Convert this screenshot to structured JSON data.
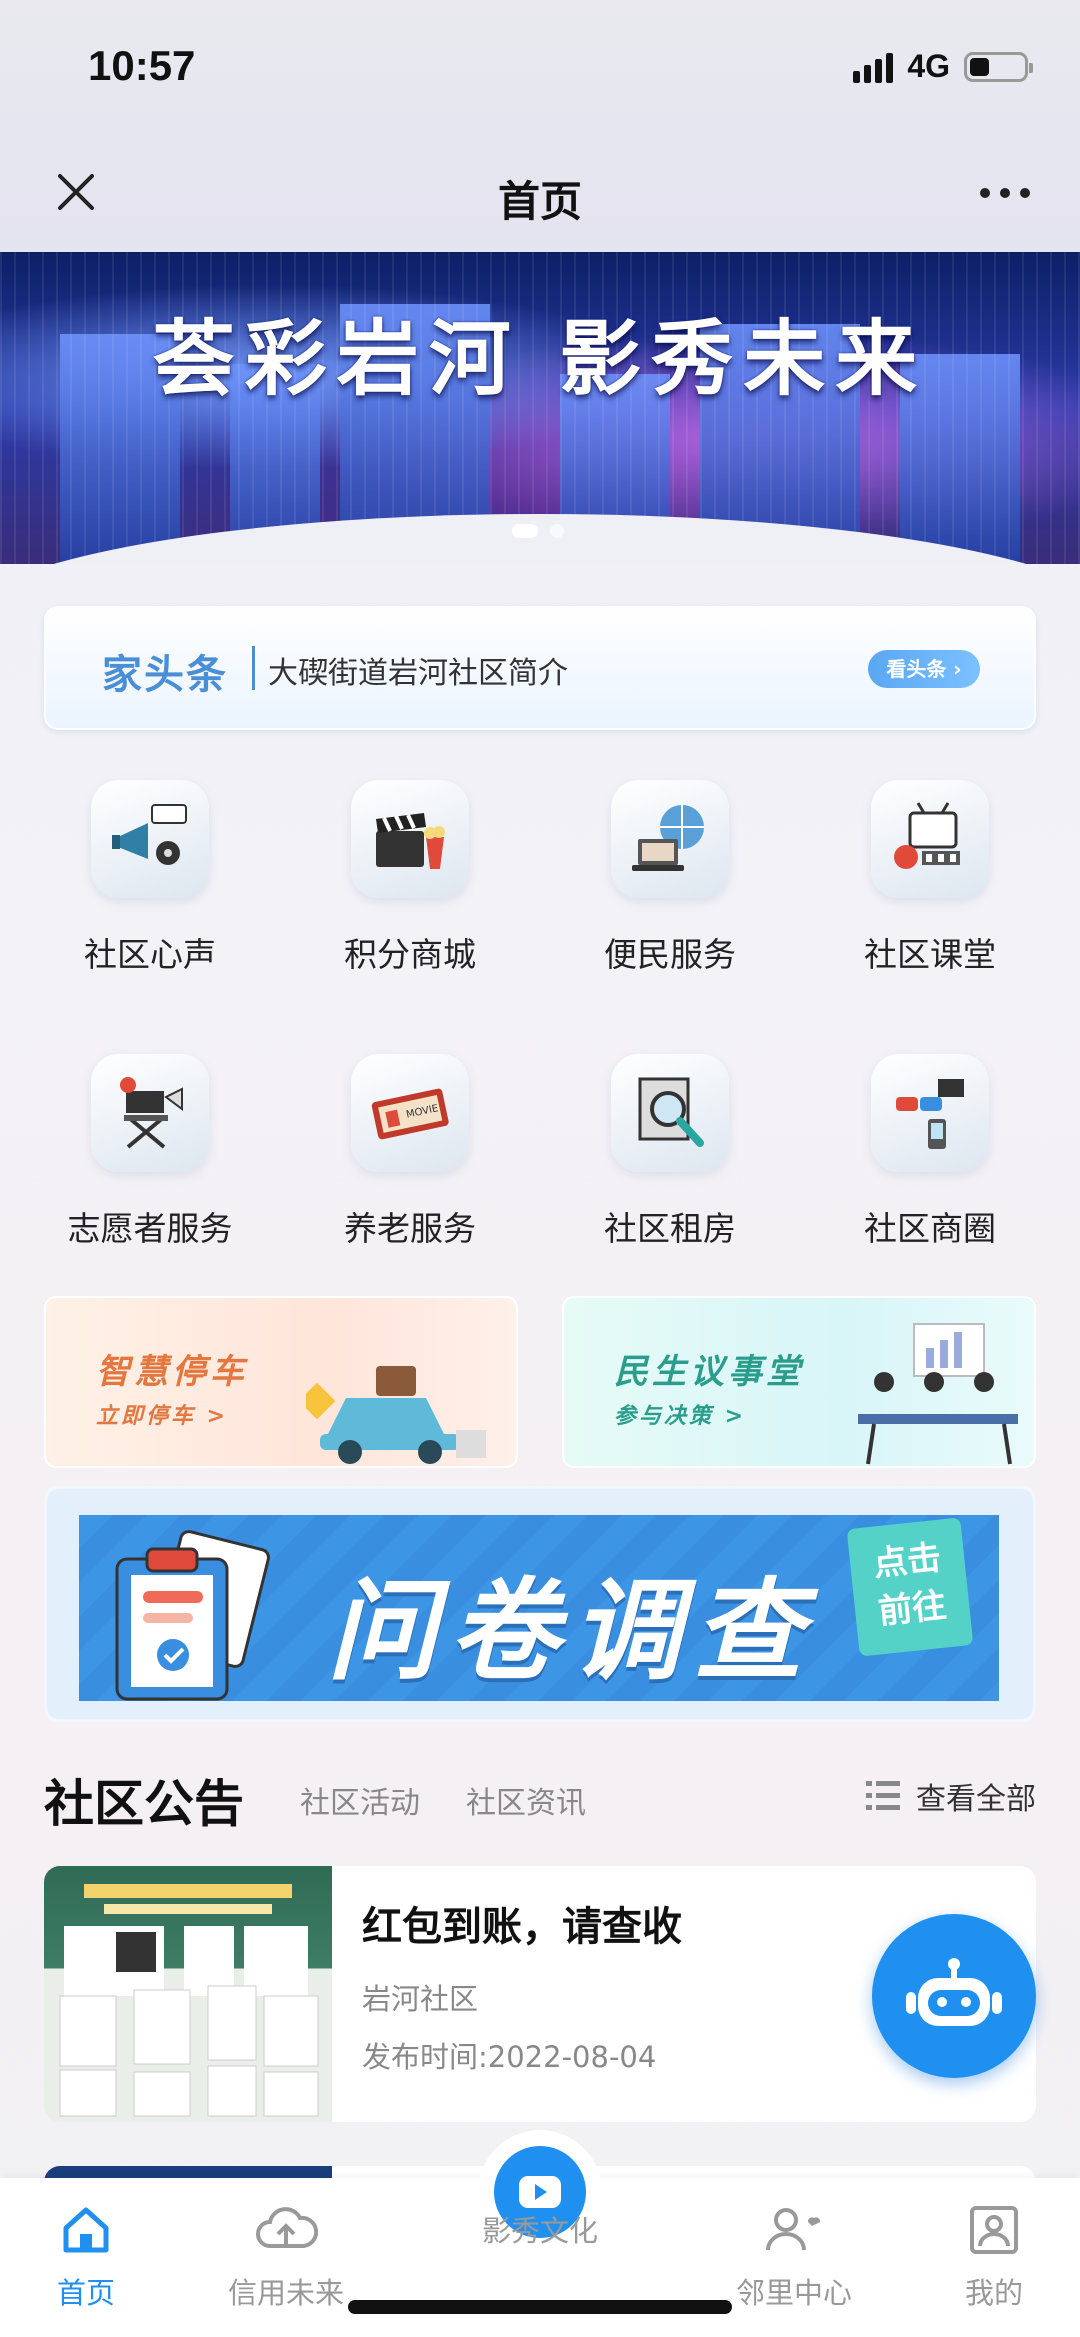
{
  "status": {
    "time": "10:57",
    "network": "4G"
  },
  "nav": {
    "title": "首页"
  },
  "banner": {
    "title": "荟彩岩河 影秀未来"
  },
  "headline": {
    "brand": "家头条",
    "text": "大碶街道岩河社区简介",
    "button": "看头条 ›"
  },
  "grid": [
    {
      "label": "社区心声",
      "icon": "megaphone-icon"
    },
    {
      "label": "积分商城",
      "icon": "clapperboard-icon"
    },
    {
      "label": "便民服务",
      "icon": "globe-laptop-icon"
    },
    {
      "label": "社区课堂",
      "icon": "tv-icon"
    },
    {
      "label": "志愿者服务",
      "icon": "director-chair-icon"
    },
    {
      "label": "养老服务",
      "icon": "movie-ticket-icon"
    },
    {
      "label": "社区租房",
      "icon": "magnifier-icon"
    },
    {
      "label": "社区商圈",
      "icon": "3d-glasses-icon"
    }
  ],
  "cards": {
    "parking": {
      "title": "智慧停车",
      "sub": "立即停车 >"
    },
    "council": {
      "title": "民生议事堂",
      "sub": "参与决策 >"
    }
  },
  "survey": {
    "title": "问卷调查",
    "sign": "点击前往"
  },
  "section": {
    "title": "社区公告",
    "tab1": "社区活动",
    "tab2": "社区资讯",
    "view_all": "查看全部"
  },
  "news": {
    "title": "红包到账，请查收",
    "source": "岩河社区",
    "date": "发布时间:2022-08-04"
  },
  "tabs": [
    {
      "label": "首页",
      "icon": "home-icon"
    },
    {
      "label": "信用未来",
      "icon": "cloud-upload-icon"
    },
    {
      "label": "影秀文化",
      "icon": "play-icon"
    },
    {
      "label": "邻里中心",
      "icon": "person-heart-icon"
    },
    {
      "label": "我的",
      "icon": "profile-icon"
    }
  ],
  "colors": {
    "accent": "#1f8ff0",
    "brand_blue": "#4a8fd6"
  }
}
